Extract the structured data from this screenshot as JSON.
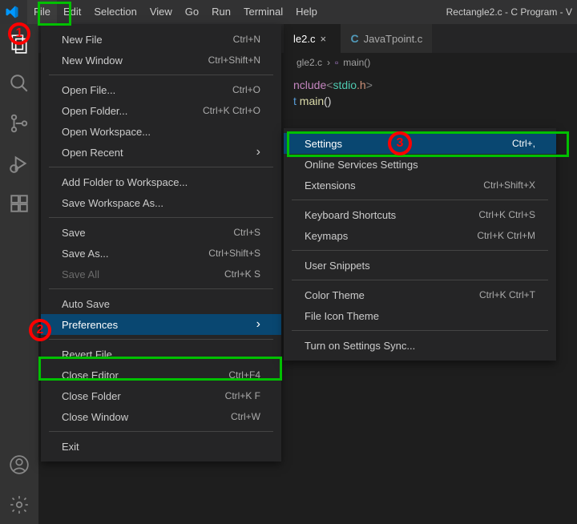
{
  "titlebar": {
    "menu": [
      "File",
      "Edit",
      "Selection",
      "View",
      "Go",
      "Run",
      "Terminal",
      "Help"
    ],
    "active_index": 0,
    "window_title": "Rectangle2.c - C Program - V"
  },
  "tabs": {
    "active": {
      "label": "le2.c",
      "close": "×"
    },
    "other": {
      "label": "JavaTpoint.c"
    }
  },
  "breadcrumb": {
    "file": "gle2.c",
    "chev": "›",
    "fn": "main()"
  },
  "code": {
    "line1_a": "nclude",
    "line1_b": "<",
    "line1_c": "stdio",
    "line1_d": ".h",
    "line1_e": ">",
    "line2_a": "t ",
    "line2_b": "main",
    "line2_c": "()"
  },
  "file_menu": [
    {
      "type": "item",
      "label": "New File",
      "shortcut": "Ctrl+N"
    },
    {
      "type": "item",
      "label": "New Window",
      "shortcut": "Ctrl+Shift+N"
    },
    {
      "type": "sep"
    },
    {
      "type": "item",
      "label": "Open File...",
      "shortcut": "Ctrl+O"
    },
    {
      "type": "item",
      "label": "Open Folder...",
      "shortcut": "Ctrl+K Ctrl+O"
    },
    {
      "type": "item",
      "label": "Open Workspace..."
    },
    {
      "type": "item",
      "label": "Open Recent",
      "submenu": true
    },
    {
      "type": "sep"
    },
    {
      "type": "item",
      "label": "Add Folder to Workspace..."
    },
    {
      "type": "item",
      "label": "Save Workspace As..."
    },
    {
      "type": "sep"
    },
    {
      "type": "item",
      "label": "Save",
      "shortcut": "Ctrl+S"
    },
    {
      "type": "item",
      "label": "Save As...",
      "shortcut": "Ctrl+Shift+S"
    },
    {
      "type": "item",
      "label": "Save All",
      "shortcut": "Ctrl+K S",
      "disabled": true
    },
    {
      "type": "sep"
    },
    {
      "type": "item",
      "label": "Auto Save"
    },
    {
      "type": "item",
      "label": "Preferences",
      "submenu": true,
      "highlight": true
    },
    {
      "type": "sep"
    },
    {
      "type": "item",
      "label": "Revert File"
    },
    {
      "type": "item",
      "label": "Close Editor",
      "shortcut": "Ctrl+F4"
    },
    {
      "type": "item",
      "label": "Close Folder",
      "shortcut": "Ctrl+K F"
    },
    {
      "type": "item",
      "label": "Close Window",
      "shortcut": "Ctrl+W"
    },
    {
      "type": "sep"
    },
    {
      "type": "item",
      "label": "Exit"
    }
  ],
  "pref_menu": [
    {
      "type": "item",
      "label": "Settings",
      "shortcut": "Ctrl+,",
      "highlight": true
    },
    {
      "type": "item",
      "label": "Online Services Settings"
    },
    {
      "type": "item",
      "label": "Extensions",
      "shortcut": "Ctrl+Shift+X"
    },
    {
      "type": "sep"
    },
    {
      "type": "item",
      "label": "Keyboard Shortcuts",
      "shortcut": "Ctrl+K Ctrl+S"
    },
    {
      "type": "item",
      "label": "Keymaps",
      "shortcut": "Ctrl+K Ctrl+M"
    },
    {
      "type": "sep"
    },
    {
      "type": "item",
      "label": "User Snippets"
    },
    {
      "type": "sep"
    },
    {
      "type": "item",
      "label": "Color Theme",
      "shortcut": "Ctrl+K Ctrl+T"
    },
    {
      "type": "item",
      "label": "File Icon Theme"
    },
    {
      "type": "sep"
    },
    {
      "type": "item",
      "label": "Turn on Settings Sync..."
    }
  ],
  "annotations": {
    "n1": "1",
    "n2": "2",
    "n3": "3"
  }
}
